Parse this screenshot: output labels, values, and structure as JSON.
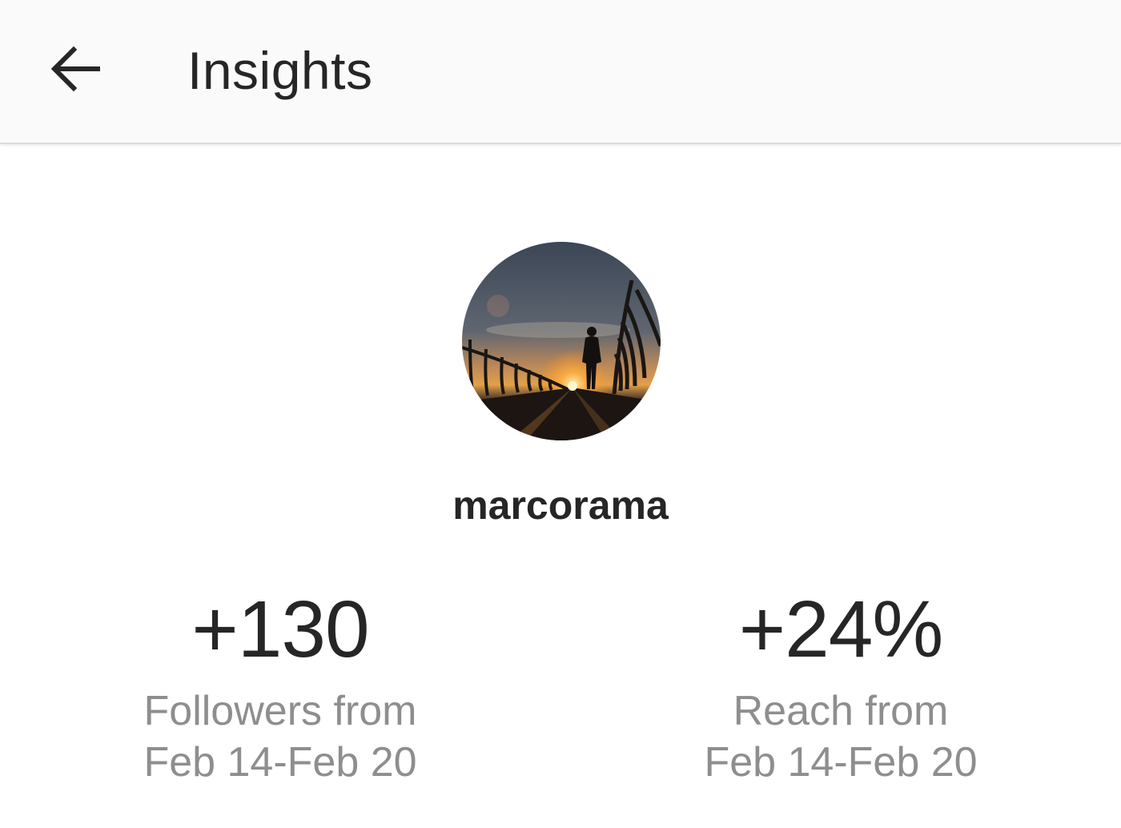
{
  "header": {
    "back_icon": "arrow-left-icon",
    "title": "Insights"
  },
  "profile": {
    "avatar_icon": "profile-photo",
    "username": "marcorama"
  },
  "stats": [
    {
      "value": "+130",
      "label_line1": "Followers from",
      "label_line2": "Feb 14-Feb 20"
    },
    {
      "value": "+24%",
      "label_line1": "Reach from",
      "label_line2": "Feb 14-Feb 20"
    }
  ],
  "colors": {
    "text_primary": "#262626",
    "text_secondary": "#8e8e8e",
    "header_bg": "#fafafa"
  }
}
